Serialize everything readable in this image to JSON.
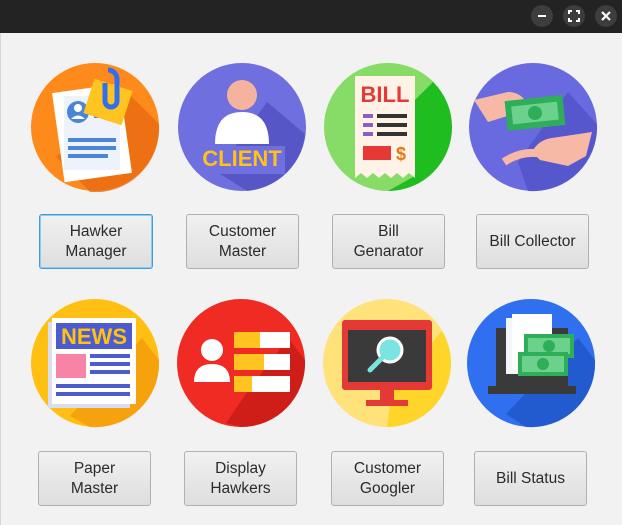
{
  "window": {
    "controls": {
      "minimize": "minimize-icon",
      "maximize": "maximize-icon",
      "close": "close-icon"
    }
  },
  "icons": {
    "hawker": {
      "colors": {
        "circle": "#ff8a1c",
        "shadow": "#e96a10"
      }
    },
    "client": {
      "text": "CLIENT",
      "colors": {
        "circle": "#6f6fe0",
        "text": "#ffc11a"
      }
    },
    "bill": {
      "text": "BILL",
      "currency": "$",
      "colors": {
        "circle": "#24c431",
        "text": "#e53935"
      }
    },
    "collector": {
      "colors": {
        "circle": "#6a6ae0",
        "money": "#2fae5a"
      }
    },
    "news": {
      "text": "NEWS",
      "colors": {
        "circle": "#ffbf13",
        "text": "#ffc30f"
      }
    },
    "display": {
      "colors": {
        "circle": "#ef2b23"
      }
    },
    "googler": {
      "colors": {
        "circle": "#ffd52a",
        "screen": "#e53935"
      }
    },
    "status": {
      "colors": {
        "circle": "#2f6ff0",
        "money": "#2fae5a"
      }
    }
  },
  "buttons": {
    "hawker_manager": "Hawker\nManager",
    "customer_master": "Customer\nMaster",
    "bill_generator": "Bill\nGenarator",
    "bill_collector": "Bill Collector",
    "paper_master": "Paper\nMaster",
    "display_hawkers": "Display\nHawkers",
    "customer_googler": "Customer\nGoogler",
    "bill_status": "Bill Status"
  }
}
